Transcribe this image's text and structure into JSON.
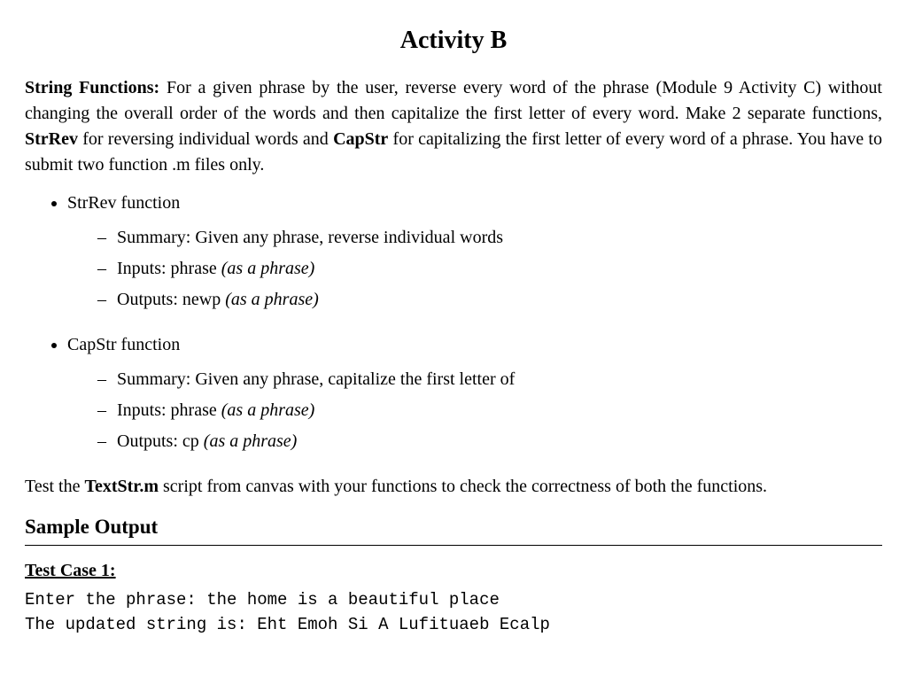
{
  "title": "Activity B",
  "intro": {
    "strong_lead": "String Functions:",
    "body_before_strrev": " For a given phrase by the user, reverse every word of the phrase (Module 9 Activity C) without changing the overall order of the words and then capitalize the first letter of every word. Make 2 separate functions, ",
    "strrev": "StrRev",
    "body_mid": " for reversing individual words and ",
    "capstr": "CapStr",
    "body_after": " for capitalizing the first letter of every word of a phrase. You have to submit two function .m files only."
  },
  "functions": [
    {
      "name": "StrRev function",
      "summary": "Summary: Given any phrase, reverse individual words",
      "inputs_label": "Inputs: phrase ",
      "inputs_hint": "(as a phrase)",
      "outputs_label": "Outputs: newp ",
      "outputs_hint": "(as a phrase)"
    },
    {
      "name": "CapStr function",
      "summary": "Summary: Given any phrase, capitalize the first letter of",
      "inputs_label": "Inputs: phrase ",
      "inputs_hint": "(as a phrase)",
      "outputs_label": "Outputs: cp ",
      "outputs_hint": "(as a phrase)"
    }
  ],
  "test_note": {
    "pre": "Test the ",
    "file": "TextStr.m",
    "post": " script from canvas with your functions to check the correctness of both the functions."
  },
  "sample_heading": "Sample Output",
  "test_case": {
    "heading": "Test Case 1:",
    "line1": "Enter the phrase: the home is a beautiful place",
    "line2": "The updated string is: Eht Emoh Si A Lufituaeb Ecalp"
  }
}
